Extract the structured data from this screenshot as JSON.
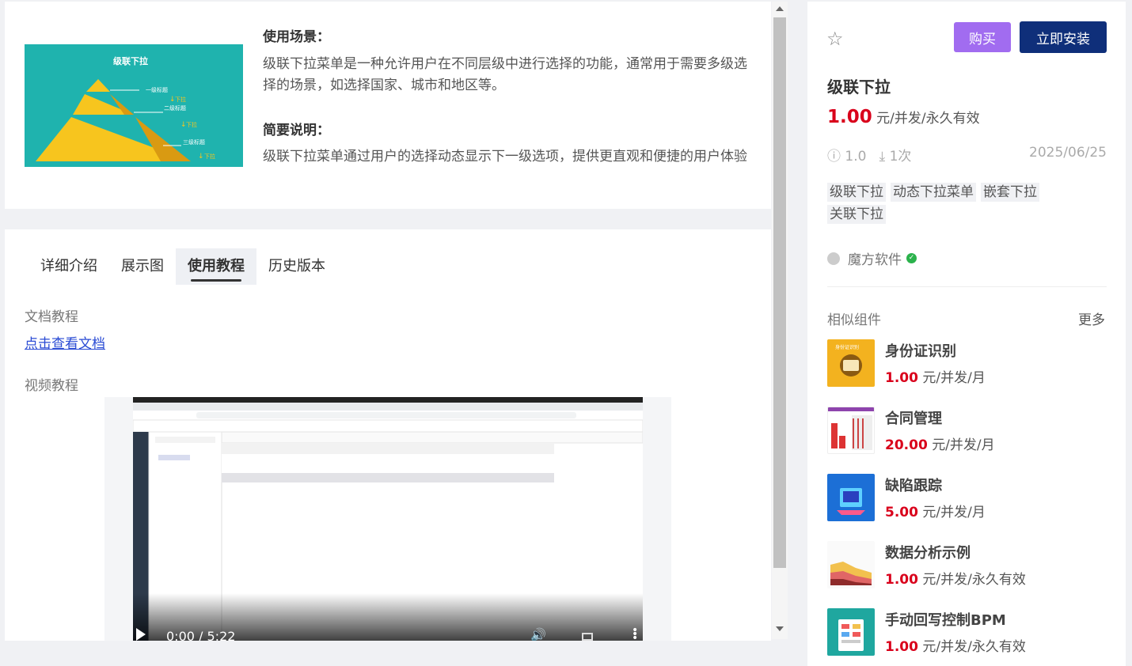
{
  "intro": {
    "thumb_title": "级联下拉",
    "thumb_labels": [
      "一级标题",
      "下拉",
      "二级标题",
      "下拉",
      "三级标题",
      "下拉"
    ],
    "scene_heading": "使用场景：",
    "scene_text": "级联下拉菜单是一种允许用户在不同层级中进行选择的功能，通常用于需要多级选择的场景，如选择国家、城市和地区等。",
    "brief_heading": "简要说明：",
    "brief_text": "级联下拉菜单通过用户的选择动态显示下一级选项，提供更直观和便捷的用户体验"
  },
  "tabs": [
    {
      "label": "详细介绍",
      "active": false
    },
    {
      "label": "展示图",
      "active": false
    },
    {
      "label": "使用教程",
      "active": true
    },
    {
      "label": "历史版本",
      "active": false
    }
  ],
  "tutorial": {
    "doc_label": "文档教程",
    "doc_link": "点击查看文档",
    "video_label": "视频教程",
    "video_time": "0:00 / 5:22"
  },
  "product": {
    "buy_label": "购买",
    "install_label": "立即安装",
    "title": "级联下拉",
    "price_value": "1.00",
    "price_unit": "元/并发/永久有效",
    "version": "1.0",
    "downloads": "1次",
    "date": "2025/06/25",
    "tags": [
      "级联下拉",
      "动态下拉菜单",
      "嵌套下拉",
      "关联下拉"
    ],
    "vendor": "魔方软件",
    "accent_color": "#0f2f7a",
    "buy_color": "#a16cf0",
    "price_color": "#d9001b"
  },
  "similar": {
    "heading": "相似组件",
    "more": "更多",
    "items": [
      {
        "name": "身份证识别",
        "price": "1.00",
        "unit": "元/并发/月"
      },
      {
        "name": "合同管理",
        "price": "20.00",
        "unit": "元/并发/月"
      },
      {
        "name": "缺陷跟踪",
        "price": "5.00",
        "unit": "元/并发/月"
      },
      {
        "name": "数据分析示例",
        "price": "1.00",
        "unit": "元/并发/永久有效"
      },
      {
        "name": "手动回写控制BPM",
        "price": "1.00",
        "unit": "元/并发/永久有效"
      }
    ]
  }
}
